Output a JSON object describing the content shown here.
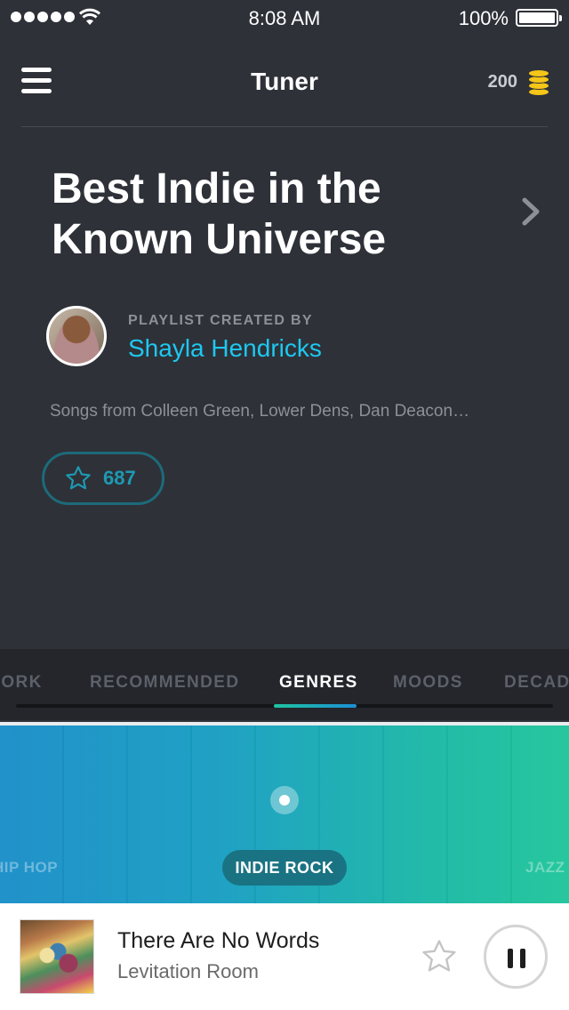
{
  "status_bar": {
    "time": "8:08 AM",
    "battery": "100%"
  },
  "header": {
    "title": "Tuner",
    "coins": "200"
  },
  "playlist": {
    "title": "Best Indie in the Known Universe",
    "created_label": "PLAYLIST CREATED BY",
    "creator": "Shayla Hendricks",
    "description": "Songs from Colleen Green, Lower Dens, Dan Deacon…",
    "favorites": "687"
  },
  "tabs": [
    {
      "label": "WORK"
    },
    {
      "label": "RECOMMENDED"
    },
    {
      "label": "GENRES",
      "active": true
    },
    {
      "label": "MOODS"
    },
    {
      "label": "DECADES"
    }
  ],
  "genres": {
    "left": "HIP HOP",
    "selected": "INDIE ROCK",
    "right": "JAZZ"
  },
  "now_playing": {
    "title": "There Are No Words",
    "artist": "Levitation Room"
  },
  "colors": {
    "background": "#2e3138",
    "accent": "#1dc8f0",
    "coin": "#f5c518",
    "tab_bar": "#24262c"
  }
}
